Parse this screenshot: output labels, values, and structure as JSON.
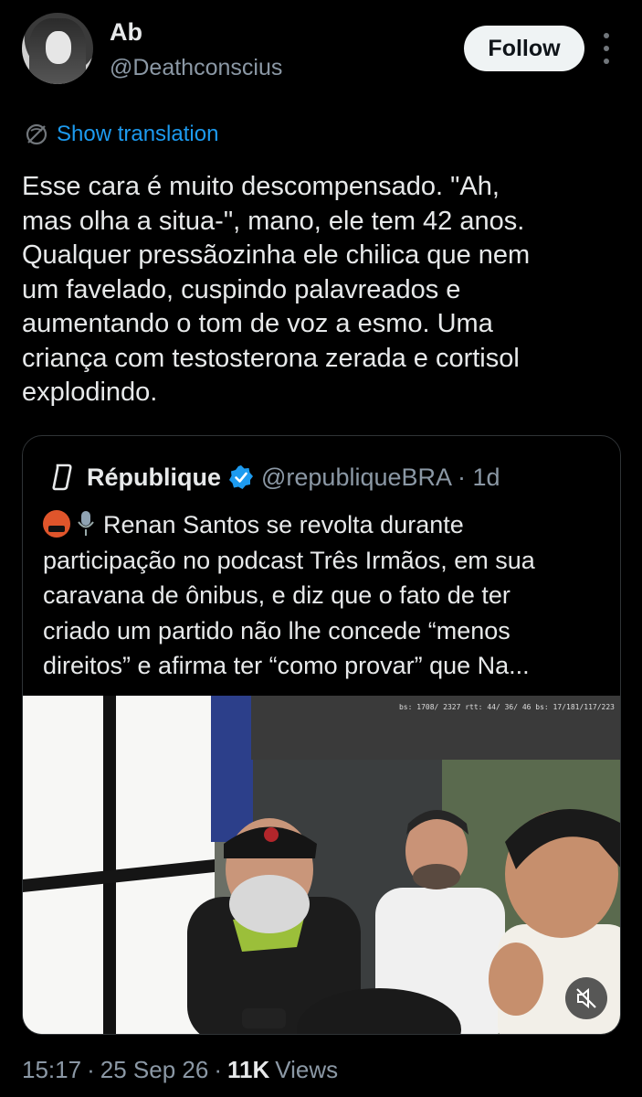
{
  "author": {
    "display_name": "Ab",
    "handle": "@Deathconscius",
    "avatar_icon": "avatar-photo"
  },
  "follow_label": "Follow",
  "translation_label": "Show translation",
  "tweet_lines": [
    "Esse cara é muito descompensado. \"Ah,",
    "mas olha a situa-\", mano, ele tem 42 anos.",
    "Qualquer pressãozinha ele chilica que nem",
    "um favelado, cuspindo palavreados e",
    "aumentando o tom de voz a esmo. Uma",
    "criança com testosterona zerada e cortisol",
    "explodindo."
  ],
  "quote": {
    "name": "République",
    "handle": "@republiqueBRA",
    "age": "· 1d",
    "lines": [
      "Renan Santos se revolta durante",
      "participação no podcast Três Irmãos, em sua",
      "caravana de ônibus, e diz que o fato de ter",
      "criado um partido não lhe concede “menos",
      "direitos” e afirma ter “como provar” que Na..."
    ],
    "media_overlay": "bs: 1708/ 2327 rtt: 44/ 36/ 46 bs: 17/181/117/223"
  },
  "meta": {
    "time": "15:17",
    "date": "25 Sep 26",
    "views_count": "11K",
    "views_label": "Views"
  },
  "colors": {
    "background": "#000000",
    "text": "#e7e9ea",
    "secondary": "#8b98a5",
    "link": "#1d9bf0",
    "verified": "#1d9bf0"
  }
}
